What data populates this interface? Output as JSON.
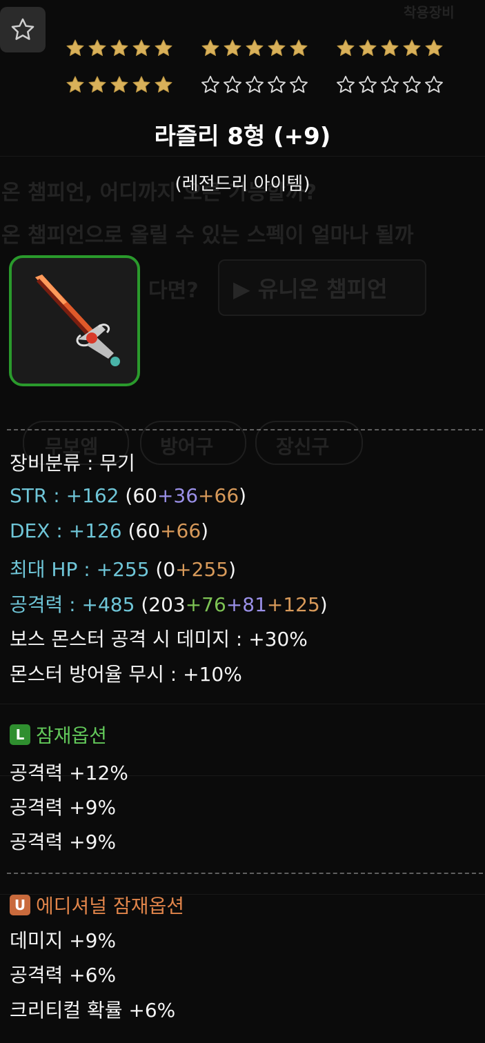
{
  "colors": {
    "star_filled": "#d9b15a",
    "star_empty": "#dcdcdc",
    "legendary_border": "#2a9a2c",
    "cyan_stat": "#6fc6d8",
    "purple_bonus": "#9a90e8",
    "orange_bonus": "#d89a5a",
    "green_bonus": "#7ec455",
    "legendary_text": "#62c85a",
    "unique_text": "#e0844a"
  },
  "star_force": {
    "filled": 20,
    "total": 30
  },
  "item": {
    "name": "라즐리 8형 (+9)",
    "grade": "(레전드리 아이템)",
    "icon": "sword-icon"
  },
  "stats": {
    "category": "장비분류 : 무기",
    "str": {
      "label": "STR : ",
      "total": "+162",
      "open": " (",
      "base": "60",
      "star": "+36",
      "add": "+66",
      "close": ")"
    },
    "dex": {
      "label": "DEX : ",
      "total": "+126",
      "open": " (",
      "base": "60",
      "add": "+66",
      "close": ")"
    },
    "hp": {
      "label": "최대 HP : ",
      "total": "+255",
      "open": " (",
      "base": "0",
      "add": "+255",
      "close": ")"
    },
    "atk": {
      "label": "공격력 : ",
      "total": "+485",
      "open": " (",
      "base": "203",
      "scroll": "+76",
      "star": "+81",
      "add": "+125",
      "close": ")"
    },
    "boss": "보스 몬스터 공격 시 데미지 : +30%",
    "ignore_def": "몬스터 방어율 무시 : +10%"
  },
  "potential": {
    "badge": "L",
    "title": "잠재옵션",
    "lines": [
      "공격력 +12%",
      "공격력 +9%",
      "공격력 +9%"
    ]
  },
  "additional": {
    "badge": "U",
    "title": "에디셔널 잠재옵션",
    "lines": [
      "데미지 +9%",
      "공격력 +6%",
      "크리티컬 확률 +6%"
    ]
  }
}
